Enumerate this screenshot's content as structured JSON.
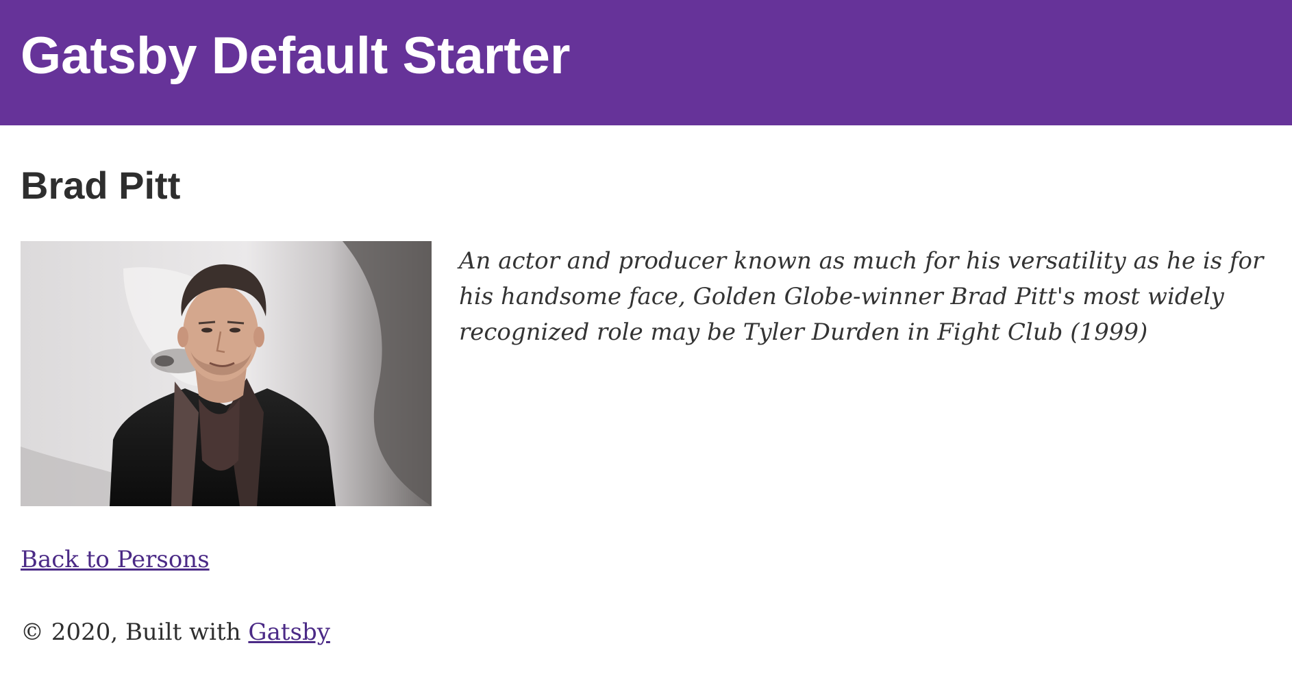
{
  "header": {
    "site_title": "Gatsby Default Starter",
    "background_color": "#663399"
  },
  "person": {
    "name": "Brad Pitt",
    "bio": "An actor and producer known as much for his versatility as he is for his handsome face, Golden Globe-winner Brad Pitt's most widely recognized role may be Tyler Durden in Fight Club (1999)",
    "photo_icon": "person-portrait-photo"
  },
  "navigation": {
    "back_label": "Back to Persons"
  },
  "footer": {
    "copyright": "© 2020, Built with",
    "link_label": "Gatsby"
  },
  "colors": {
    "accent": "#663399",
    "link": "#4b2a86",
    "text": "#2e2e2e"
  }
}
